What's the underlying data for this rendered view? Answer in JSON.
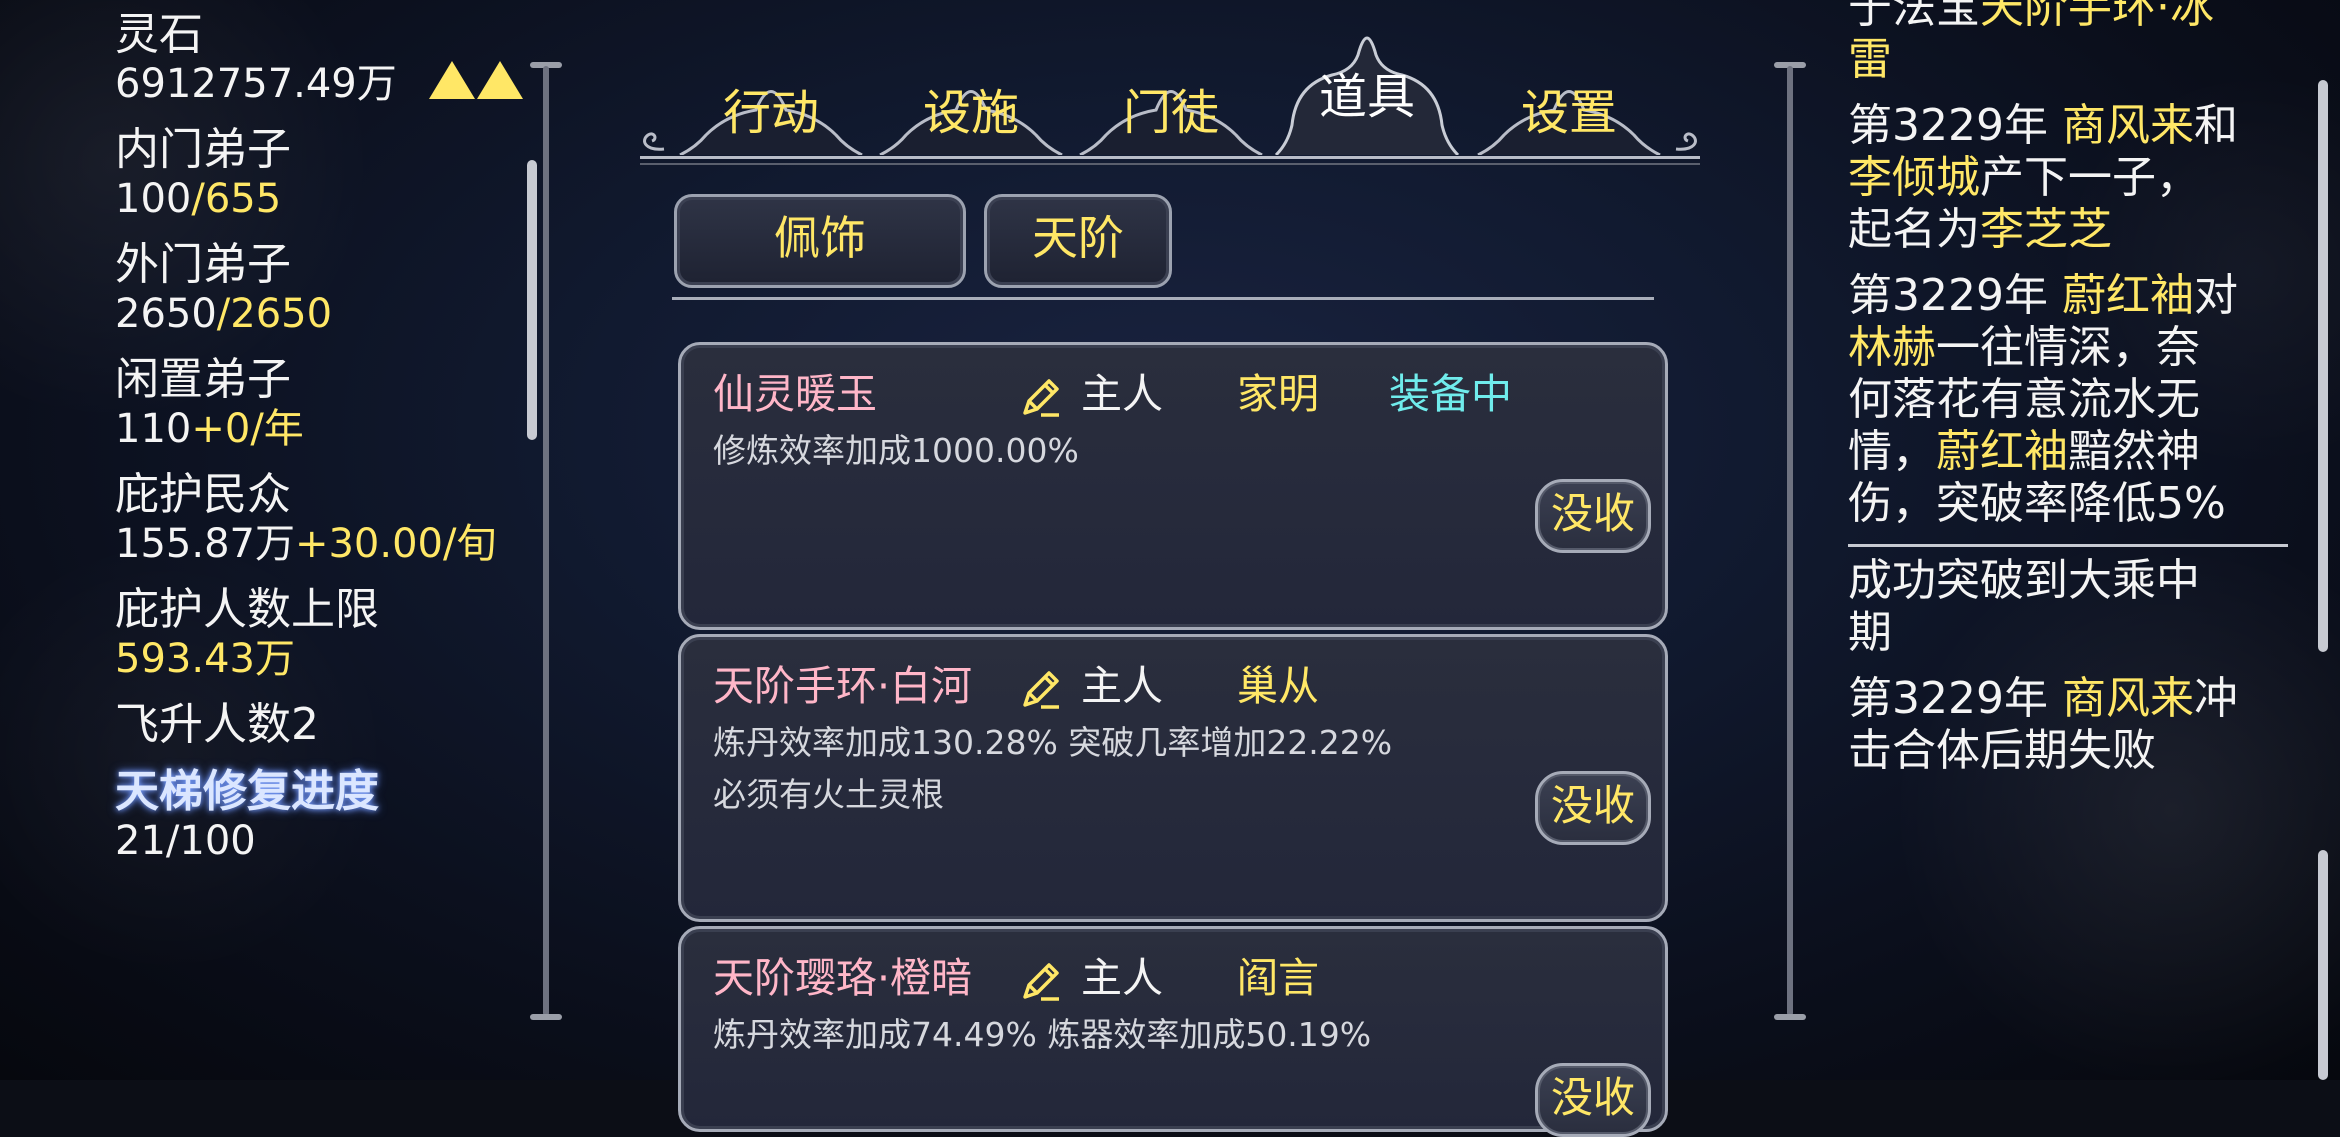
{
  "left_panel": {
    "stats": [
      {
        "label": "灵石",
        "value": "6912757.49万",
        "extra": ""
      },
      {
        "label": "内门弟子",
        "value": "100",
        "extra": "/655"
      },
      {
        "label": "外门弟子",
        "value": "2650",
        "extra": "/2650"
      },
      {
        "label": "闲置弟子",
        "value": "110",
        "extra": "+0/年"
      },
      {
        "label": "庇护民众",
        "value": "155.87万",
        "extra": "+30.00/旬"
      },
      {
        "label": "庇护人数上限",
        "value": "",
        "extra": "593.43万"
      },
      {
        "label": "飞升人数2",
        "value": "",
        "extra": ""
      }
    ],
    "ladder_title": "天梯修复进度",
    "ladder_progress": "21/100",
    "rank_icon": "double-triangle-up-icon"
  },
  "tabs": [
    {
      "label": "行动",
      "active": false
    },
    {
      "label": "设施",
      "active": false
    },
    {
      "label": "门徒",
      "active": false
    },
    {
      "label": "道具",
      "active": true
    },
    {
      "label": "设置",
      "active": false
    }
  ],
  "subtabs": [
    {
      "label": "佩饰"
    },
    {
      "label": "天阶"
    }
  ],
  "items": [
    {
      "name": "仙灵暖玉",
      "owner": "主人",
      "disciple": "家明",
      "status": "装备中",
      "desc_lines": [
        "修炼效率加成1000.00%"
      ],
      "button": "没收"
    },
    {
      "name": "天阶手环·白河",
      "owner": "主人",
      "disciple": "巢从",
      "status": "",
      "desc_lines": [
        "炼丹效率加成130.28% 突破几率增加22.22%",
        "必须有火土灵根"
      ],
      "button": "没收"
    },
    {
      "name": "天阶璎珞·橙暗",
      "owner": "主人",
      "disciple": "阎言",
      "status": "",
      "desc_lines": [
        "炼丹效率加成74.49% 炼器效率加成50.19%",
        ""
      ],
      "button": "没收"
    }
  ],
  "log": {
    "entries": [
      {
        "parts": [
          {
            "t": "于法宝",
            "y": false
          },
          {
            "t": "天阶手环·冰",
            "y": true
          }
        ]
      },
      {
        "parts": [
          {
            "t": "雷",
            "y": true
          }
        ]
      },
      {
        "parts": [
          {
            "t": "第3229年 ",
            "y": false
          },
          {
            "t": "商风来",
            "y": true
          },
          {
            "t": "和",
            "y": false
          }
        ]
      },
      {
        "parts": [
          {
            "t": "李倾城",
            "y": true
          },
          {
            "t": "产下一子，",
            "y": false
          }
        ]
      },
      {
        "parts": [
          {
            "t": "起名为",
            "y": false
          },
          {
            "t": "李芝芝",
            "y": true
          }
        ]
      },
      {
        "parts": [
          {
            "t": "第3229年 ",
            "y": false
          },
          {
            "t": "蔚红袖",
            "y": true
          },
          {
            "t": "对",
            "y": false
          }
        ]
      },
      {
        "parts": [
          {
            "t": "林赫",
            "y": true
          },
          {
            "t": "一往情深，奈",
            "y": false
          }
        ]
      },
      {
        "parts": [
          {
            "t": "何落花有意流水无",
            "y": false
          }
        ]
      },
      {
        "parts": [
          {
            "t": "情，",
            "y": false
          },
          {
            "t": "蔚红袖",
            "y": true
          },
          {
            "t": "黯然神",
            "y": false
          }
        ]
      },
      {
        "parts": [
          {
            "t": "伤，突破率降低5%",
            "y": false
          }
        ]
      },
      {
        "parts": [
          {
            "t": "成功突破到大乘中",
            "y": false
          }
        ]
      },
      {
        "parts": [
          {
            "t": "期",
            "y": false
          }
        ]
      },
      {
        "parts": [
          {
            "t": "第3229年 ",
            "y": false
          },
          {
            "t": "商风来",
            "y": true
          },
          {
            "t": "冲",
            "y": false
          }
        ]
      },
      {
        "parts": [
          {
            "t": "击合体后期失败",
            "y": false
          }
        ]
      }
    ]
  }
}
